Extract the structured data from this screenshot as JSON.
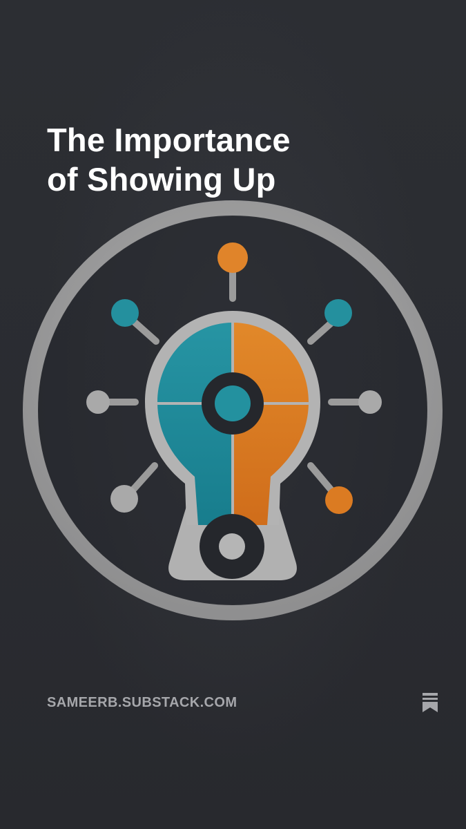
{
  "post": {
    "title_line_1": "The Importance",
    "title_line_2": "of Showing Up"
  },
  "footer": {
    "domain": "SAMEERB.SUBSTACK.COM",
    "bookmark_icon": "bookmark-icon"
  },
  "colors": {
    "background": "#2b2d33",
    "ring": "#9c9c9c",
    "teal": "#1f8a9a",
    "orange": "#d9781f",
    "dark": "#25272c"
  }
}
